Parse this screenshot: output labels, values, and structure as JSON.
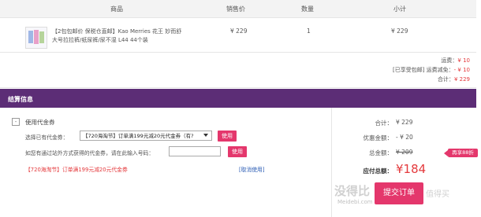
{
  "table_header": {
    "product": "商品",
    "sale_price": "销售价",
    "quantity": "数量",
    "subtotal": "小计"
  },
  "item": {
    "name": "【2包包邮价 保税仓直邮】Kao Merries 花王 妙而舒 大号拉拉裤/纸尿裤/尿不湿 L44 44个装",
    "price": "¥ 229",
    "qty": "1",
    "subtotal": "¥ 229"
  },
  "summary": {
    "shipping_label": "运费：",
    "shipping_value": "¥ 10",
    "discount_label": "[已享受包邮] 运费减免：",
    "discount_value": "- ¥ 10",
    "total_label": "合计：",
    "total_value": "¥ 229"
  },
  "settle": {
    "title": "结算信息",
    "checkbox_mark": "-",
    "use_voucher": "使用代金券",
    "choose_voucher": "选择已有代金券：",
    "voucher_selected": "【720海淘节】订单满199元减20元代金券（有?",
    "use_button": "使用",
    "code_prompt": "如您有通过站外方式获得的代金券，请在此输入号码：",
    "code_use_button": "使用",
    "applied_voucher": "【720海淘节】订单满199元减20元代金券",
    "cancel_link": "[取消使用]"
  },
  "totals": {
    "subtotal_label": "合计：",
    "subtotal_value": "¥ 229",
    "discount_label": "优惠金额：",
    "discount_value": "- ¥ 20",
    "gross_label": "总金额：",
    "gross_value": "¥ 209",
    "badge": "再享88折",
    "payable_label": "应付总额：",
    "payable_value": "¥184"
  },
  "submit_label": "提交订单",
  "watermark": {
    "main": "没得比",
    "sub": "Meidebi.com",
    "right": "值得买"
  },
  "colors": {
    "accent_purple": "#5c2d76",
    "accent_pink": "#e4376c",
    "price_red": "#e4393c"
  }
}
